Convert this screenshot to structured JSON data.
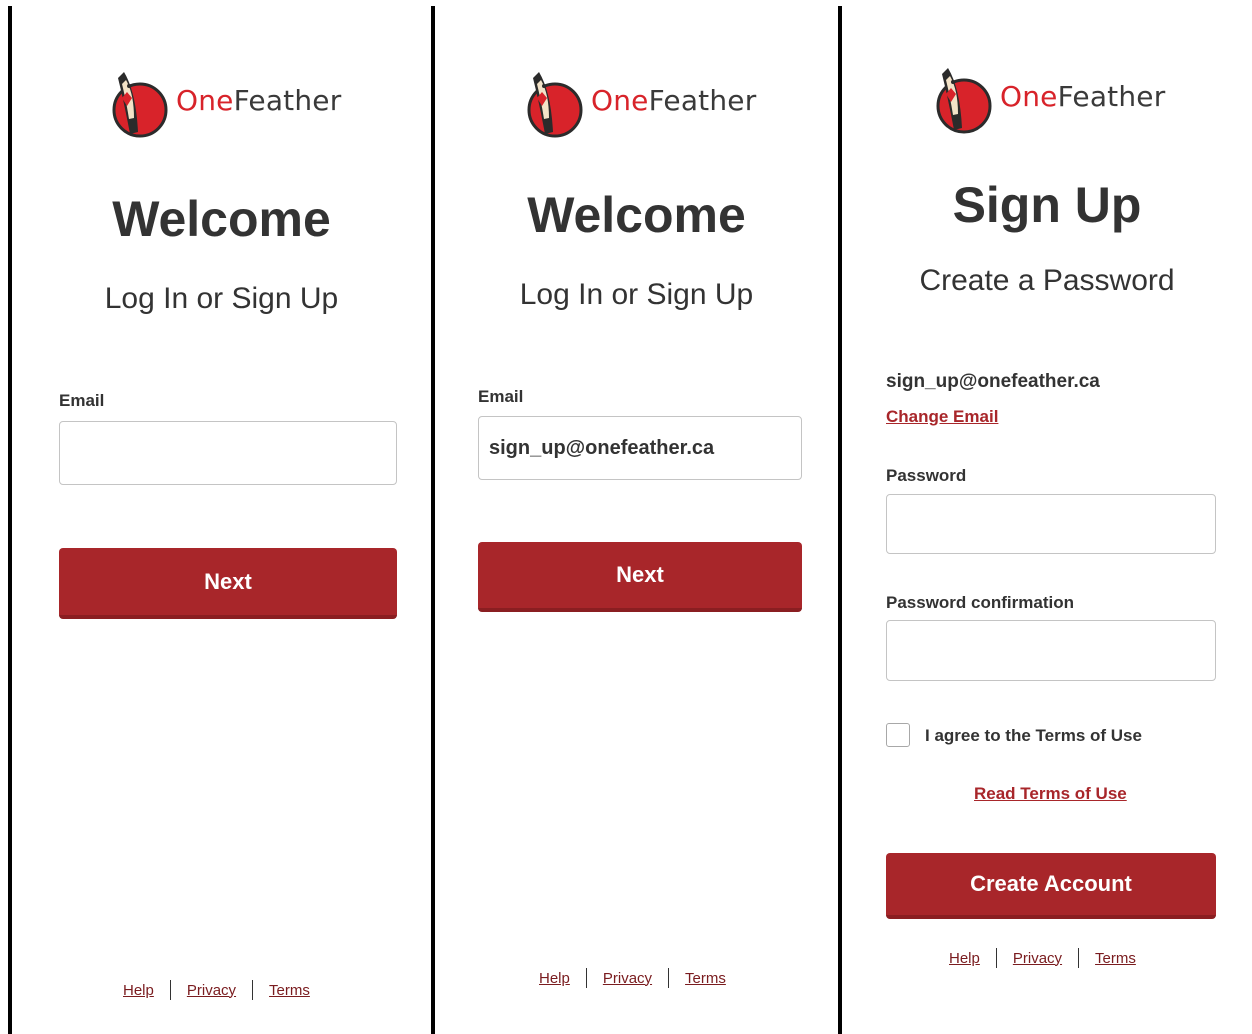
{
  "brand": {
    "one": "One",
    "feather": "Feather",
    "primary_color": "#a8262a",
    "logo_red": "#d8232a"
  },
  "screen1": {
    "title": "Welcome",
    "subtitle": "Log In or Sign Up",
    "email_label": "Email",
    "email_value": "",
    "next_label": "Next",
    "footer": {
      "help": "Help",
      "privacy": "Privacy",
      "terms": "Terms"
    }
  },
  "screen2": {
    "title": "Welcome",
    "subtitle": "Log In or Sign Up",
    "email_label": "Email",
    "email_value": "sign_up@onefeather.ca",
    "next_label": "Next",
    "footer": {
      "help": "Help",
      "privacy": "Privacy",
      "terms": "Terms"
    }
  },
  "screen3": {
    "title": "Sign Up",
    "subtitle": "Create a Password",
    "email_display": "sign_up@onefeather.ca",
    "change_email": "Change Email",
    "password_label": "Password",
    "password_confirm_label": "Password confirmation",
    "agree_label": "I agree to the Terms of Use",
    "read_terms": "Read Terms of Use",
    "create_account_label": "Create Account",
    "footer": {
      "help": "Help",
      "privacy": "Privacy",
      "terms": "Terms"
    }
  }
}
